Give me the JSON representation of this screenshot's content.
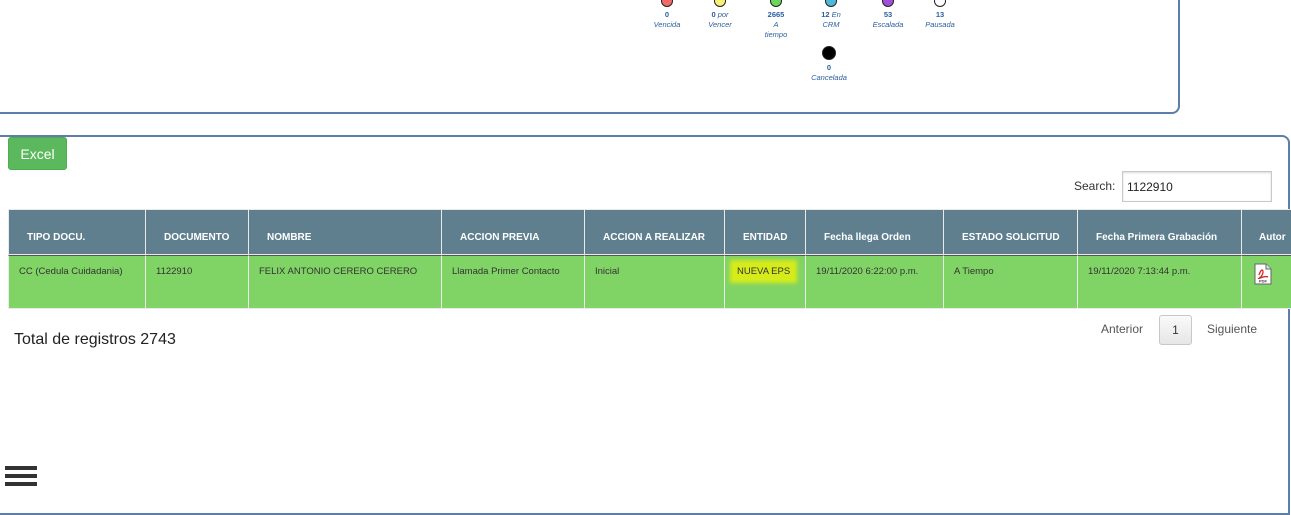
{
  "status_indicators": [
    {
      "count": "0",
      "label": "Vencida",
      "color": "#f26b6b"
    },
    {
      "count": "0",
      "label_pre": "por",
      "label": "Vencer",
      "color": "#f7f07a"
    },
    {
      "count": "2665",
      "label": "A tiempo",
      "color": "#6dd65a"
    },
    {
      "count": "12",
      "label_pre": "En",
      "label": "CRM",
      "color": "#4fb8d8"
    },
    {
      "count": "53",
      "label": "Escalada",
      "color": "#a24fd8"
    },
    {
      "count": "13",
      "label": "Pausada",
      "color": "#ffffff"
    },
    {
      "count": "0",
      "label": "Cancelada",
      "color": "#000000"
    }
  ],
  "toolbar": {
    "excel_label": "Excel",
    "search_label": "Search:",
    "search_value": "1122910"
  },
  "table": {
    "columns": [
      "TIPO DOCU.",
      "DOCUMENTO",
      "NOMBRE",
      "ACCION PREVIA",
      "ACCION A REALIZAR",
      "ENTIDAD",
      "Fecha llega Orden",
      "ESTADO SOLICITUD",
      "Fecha Primera Grabación",
      "Autor"
    ],
    "rows": [
      {
        "tipo_docu": "CC (Cedula Cuidadania)",
        "documento": "1122910",
        "nombre": "FELIX ANTONIO CERERO CERERO",
        "accion_previa": "Llamada Primer Contacto",
        "accion_realizar": "Inicial",
        "entidad": "NUEVA EPS",
        "fecha_llega": "19/11/2020 6:22:00 p.m.",
        "estado": "A Tiempo",
        "fecha_grabacion": "19/11/2020 7:13:44 p.m.",
        "autor_icon": "pdf-file-icon"
      }
    ],
    "header_color": "#5f7f8f",
    "row_color": "#80d365",
    "highlight_color": "#d6ec1a"
  },
  "footer": {
    "total_label": "Total de registros 2743",
    "prev_label": "Anterior",
    "page": "1",
    "next_label": "Siguiente"
  },
  "accent_color": "#5cb85c",
  "panel_border_color": "#5b7fa8"
}
